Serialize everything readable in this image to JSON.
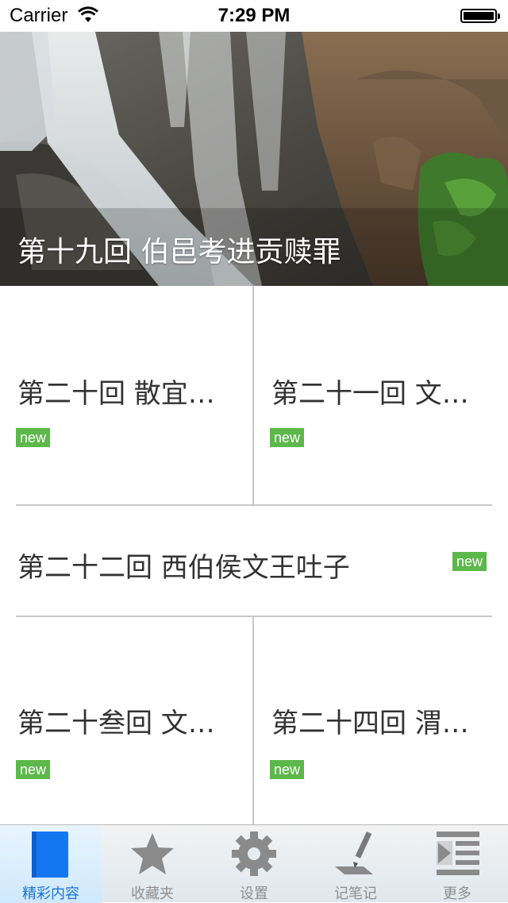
{
  "status_bar": {
    "carrier": "Carrier",
    "time": "7:29 PM"
  },
  "hero": {
    "title": "第十九回 伯邑考进贡赎罪"
  },
  "items": [
    {
      "title": "第二十回 散宜…",
      "badge": "new"
    },
    {
      "title": "第二十一回 文…",
      "badge": "new"
    },
    {
      "title": "第二十二回 西伯侯文王吐子",
      "badge": "new"
    },
    {
      "title": "第二十叁回 文…",
      "badge": "new"
    },
    {
      "title": "第二十四回 渭…",
      "badge": "new"
    }
  ],
  "tabs": [
    {
      "label": "精彩内容",
      "icon": "book-icon",
      "active": true
    },
    {
      "label": "收藏夹",
      "icon": "star-icon"
    },
    {
      "label": "设置",
      "icon": "gear-icon"
    },
    {
      "label": "记笔记",
      "icon": "pen-icon"
    },
    {
      "label": "更多",
      "icon": "more-list-icon"
    }
  ],
  "colors": {
    "badge": "#5cb84a",
    "active_tab": "#1a73d9",
    "divider": "#c8c8c8"
  }
}
